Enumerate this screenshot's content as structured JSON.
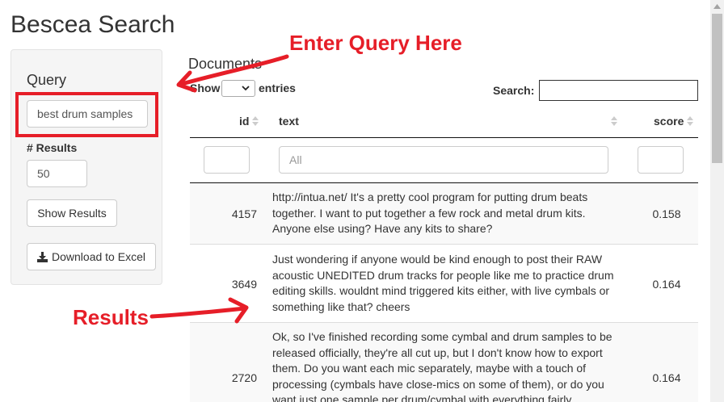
{
  "app": {
    "title": "Bescea Search"
  },
  "sidebar": {
    "query_label": "Query",
    "query_value": "best drum samples",
    "results_label": "# Results",
    "results_value": "50",
    "show_button": "Show Results",
    "download_button": "Download to Excel",
    "download_icon": "download-icon"
  },
  "table": {
    "title": "Documents",
    "show_label": "Show",
    "entries_label": "entries",
    "search_label": "Search:",
    "search_value": "",
    "columns": [
      "id",
      "text",
      "score"
    ],
    "filter_text_placeholder": "All",
    "rows": [
      {
        "id": "4157",
        "text": "http://intua.net/ It's a pretty cool program for putting drum beats together. I want to put together a few rock and metal drum kits. Anyone else using? Have any kits to share?",
        "score": "0.158"
      },
      {
        "id": "3649",
        "text": "Just wondering if anyone would be kind enough to post their RAW acoustic UNEDITED drum tracks for people like me to practice drum editing skills. wouldnt mind triggered kits either, with live cymbals or something like that? cheers",
        "score": "0.164"
      },
      {
        "id": "2720",
        "text": "Ok, so I've finished recording some cymbal and drum samples to be released officially, they're all cut up, but I don't know how to export them. Do you want each mic separately, maybe with a touch of processing (cymbals have close-mics on some of them), or do you want just one sample per drum/cymbal with everything fairly",
        "score": "0.164"
      }
    ]
  },
  "annotations": {
    "query": "Enter Query Here",
    "results": "Results",
    "color": "#e61e28"
  }
}
